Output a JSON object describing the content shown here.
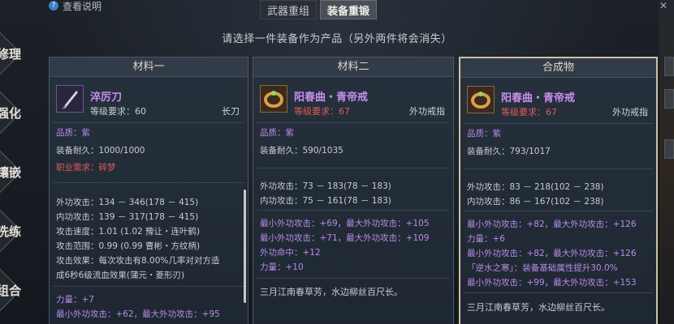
{
  "help": {
    "label": "查看说明"
  },
  "tabs": [
    {
      "label": "武器重组",
      "active": false
    },
    {
      "label": "装备重锻",
      "active": true
    }
  ],
  "instruction": "请选择一件装备作为产品（另外两件将会消失）",
  "sidebar": [
    "修理",
    "强化",
    "镶嵌",
    "洗练",
    "组合"
  ],
  "panels": [
    {
      "header": "材料一",
      "name": "淬厉刀",
      "level_label": "等级要求：",
      "level_value": "60",
      "item_type": "长刀",
      "quality": "品质：紫",
      "durability": "装备耐久：1000/1000",
      "job": "职业需求：碎梦",
      "stats": [
        "外功攻击：134 － 346(178 － 415)",
        "内功攻击：139 － 317(178 － 415)",
        "攻击速度：1.01 (1.02 豫让・连叶鹤)",
        "攻击范围：0.99 (0.99 曹彬・方纹柄)",
        "攻击效果：每次攻击有8.00%几率对对方造",
        "成6秒6级流血效果(蒲元・菱形刃)"
      ],
      "extras": [
        "力量：+7",
        "最小外功攻击：+62，最大外功攻击：+95"
      ]
    },
    {
      "header": "材料二",
      "name": "阳春曲・青帝戒",
      "level_label": "等级要求：",
      "level_value": "67",
      "item_type": "外功戒指",
      "quality": "品质：紫",
      "durability": "装备耐久：590/1035",
      "stats": [
        "外功攻击：73 － 183(78 － 183)",
        "内功攻击：75 － 161(78 － 183)"
      ],
      "extras": [
        "最小外功攻击：+69，最大外功攻击：+105",
        "最小外功攻击：+71，最大外功攻击：+109",
        "外功命中：+12",
        "力量：+10"
      ],
      "poem": "三月江南春草芳，水边柳丝百尺长。"
    },
    {
      "header": "合成物",
      "name": "阳春曲・青帝戒",
      "level_label": "等级要求：",
      "level_value": "67",
      "item_type": "外功戒指",
      "quality": "品质：紫",
      "durability": "装备耐久：793/1017",
      "stats": [
        "外功攻击：83 － 218(102 － 238)",
        "内功攻击：86 － 167(102 － 238)"
      ],
      "extras": [
        "最小外功攻击：+82，最大外功攻击：+126",
        "力量：+6",
        "最小外功攻击：+82，最大外功攻击：+126",
        "「逆水之寒」：装备基础属性提升30.0%",
        "最小外功攻击：+99，最大外功攻击：+153"
      ],
      "poem": "三月江南春草芳，水边柳丝百尺长。"
    }
  ],
  "colors": {
    "purple_name": "#c98df0",
    "red_req": "#e05a5a",
    "green": "#64c765",
    "selected_border": "#cbc3a6"
  }
}
